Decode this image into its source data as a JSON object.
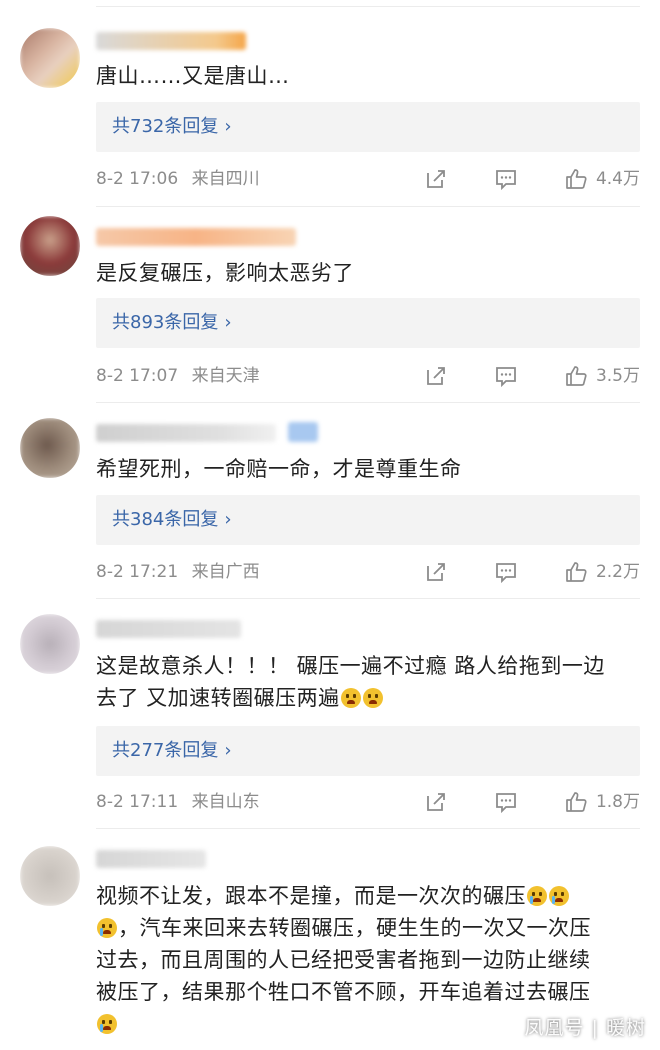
{
  "comments": [
    {
      "text": "唐山……又是唐山…",
      "replies_label": "共732条回复",
      "time": "8-2 17:06",
      "location": "来自四川",
      "likes": "4.4万"
    },
    {
      "text": "是反复碾压，影响太恶劣了",
      "replies_label": "共893条回复",
      "time": "8-2 17:07",
      "location": "来自天津",
      "likes": "3.5万"
    },
    {
      "text": "希望死刑，一命赔一命，才是尊重生命",
      "replies_label": "共384条回复",
      "time": "8-2 17:21",
      "location": "来自广西",
      "likes": "2.2万"
    },
    {
      "text_line1": "这是故意杀人！！！ 碾压一遍不过瘾 路人给拖到一边",
      "text_line2": "去了 又加速转圈碾压两遍",
      "replies_label": "共277条回复",
      "time": "8-2 17:11",
      "location": "来自山东",
      "likes": "1.8万"
    },
    {
      "text_line1": "视频不让发，跟本不是撞，而是一次次的碾压",
      "text_line2": "，汽车来回来去转圈碾压，硬生生的一次又一次压",
      "text_line3": "过去，而且周围的人已经把受害者拖到一边防止继续",
      "text_line4": "被压了，结果那个牲口不管不顾，开车追着过去碾压"
    }
  ],
  "watermark": "凤凰号 | 暖树",
  "colors": {
    "link": "#3a66a8",
    "meta": "#8c8c8c",
    "reply_bg": "#f3f3f3"
  },
  "icons": [
    "share-icon",
    "comment-icon",
    "like-icon",
    "angry-emoji",
    "cry-emoji"
  ]
}
